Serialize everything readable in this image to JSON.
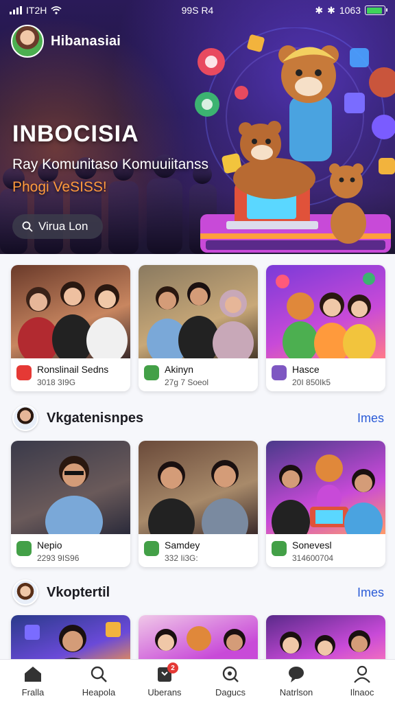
{
  "status_bar": {
    "left": "IT2H",
    "center": "99S R4",
    "right": "1063",
    "battery_percent": 88
  },
  "profile": {
    "name": "Hibanasiai"
  },
  "hero": {
    "title": "INBOCISIA",
    "subtitle": "Ray Komunitaso Komuuiitanss",
    "accent": "Phogi VeSISS!",
    "button_label": "Virua Lon"
  },
  "row1": [
    {
      "title": "Ronslinail Sedns",
      "meta": "3018 3I9G"
    },
    {
      "title": "Akinyn",
      "meta": "27g 7 Soeol"
    },
    {
      "title": "Hasce",
      "meta": "20I 850Ik5"
    }
  ],
  "section1": {
    "title": "Vkgatenisnpes",
    "link": "Imes"
  },
  "row2": [
    {
      "title": "Nepio",
      "meta": "2293 9IS96"
    },
    {
      "title": "Samdey",
      "meta": "332 Ii3G:"
    },
    {
      "title": "Sonevesl",
      "meta": "314600704"
    }
  ],
  "section2": {
    "title": "Vkoptertil",
    "link": "Imes"
  },
  "tabs": [
    {
      "label": "Fralla",
      "icon": "home-icon"
    },
    {
      "label": "Heapola",
      "icon": "search-icon"
    },
    {
      "label": "Uberans",
      "icon": "inbox-icon",
      "badge": "2"
    },
    {
      "label": "Dagucs",
      "icon": "explore-icon"
    },
    {
      "label": "Natrlson",
      "icon": "chat-icon"
    },
    {
      "label": "Ilnaoc",
      "icon": "profile-icon"
    }
  ],
  "colors": {
    "accent": "#2a5bd7",
    "hero_accent": "#ff9a3c",
    "badge": "#e53935"
  }
}
